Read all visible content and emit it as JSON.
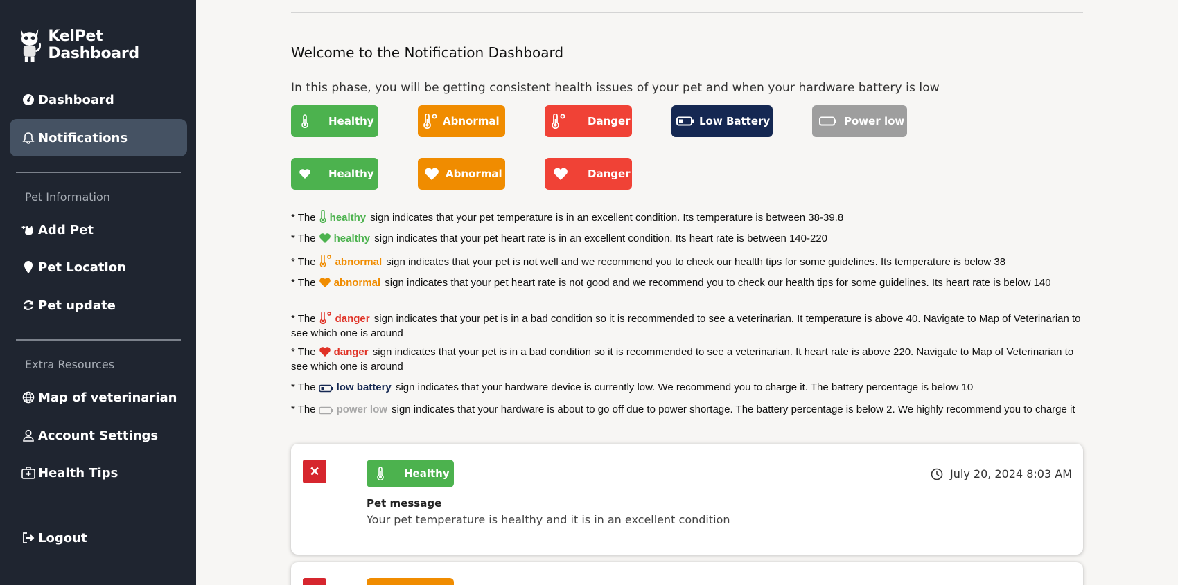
{
  "brand": {
    "title": "KelPet Dashboard"
  },
  "nav": {
    "dashboard": "Dashboard",
    "notifications": "Notifications",
    "pet_section": "Pet Information",
    "add_pet": "Add Pet",
    "pet_location": "Pet Location",
    "pet_update": "Pet update",
    "extra_section": "Extra Resources",
    "map_vet": "Map of veterinarian",
    "account": "Account Settings",
    "health_tips": "Health Tips",
    "logout": "Logout"
  },
  "page": {
    "title": "Welcome to the Notification Dashboard",
    "intro": "In this phase, you will be getting consistent health issues of your pet and when your hardware battery is low"
  },
  "badges": {
    "temp_healthy": "Healthy",
    "temp_abnormal": "Abnormal",
    "temp_danger": "Danger",
    "low_battery": "Low Battery",
    "power_low": "Power low",
    "heart_healthy": "Healthy",
    "heart_abnormal": "Abnormal",
    "heart_danger": "Danger"
  },
  "legend": [
    {
      "prefix": "* The",
      "keyword": "healthy",
      "rest": " sign indicates that your pet  temperature is in an excellent condition. Its temperature is between 38-39.8"
    },
    {
      "prefix": "* The",
      "keyword": "healthy",
      "rest": " sign indicates that your pet heart rate is in an excellent condition. Its heart rate is between 140-220"
    },
    {
      "prefix": "* The",
      "keyword": "abnormal",
      "rest": " sign indicates that your pet is not well and we recommend you to check our health tips for some guidelines. Its temperature is below 38"
    },
    {
      "prefix": "* The",
      "keyword": "abnormal",
      "rest": " sign indicates that your pet  heart rate is not good and we recommend you to check our health tips for some guidelines. Its heart rate is below 140"
    },
    {
      "prefix": "* The",
      "keyword": "danger",
      "rest": " sign indicates that your pet is in a bad condition so it is recommended to see a veterinarian. It temperature is above 40. Navigate to Map of Veterinarian to see which one is around"
    },
    {
      "prefix": "* The",
      "keyword": "danger",
      "rest": " sign indicates that your pet is in a bad condition so it is recommended to see a veterinarian. It heart rate is above 220. Navigate to Map of Veterinarian to see which one is around"
    },
    {
      "prefix": "* The",
      "keyword": "low battery",
      "rest": " sign indicates that your hardware device is currently low. We recommend you to charge it. The battery percentage is below 10"
    },
    {
      "prefix": "* The",
      "keyword": "power low",
      "rest": " sign indicates that your hardware is about to go off due to power shortage. The battery percentage is below 2. We highly recommend you to charge it"
    }
  ],
  "notification": {
    "close": "✕",
    "badge": "Healthy",
    "time": "July 20, 2024 8:03 AM",
    "title": "Pet message",
    "body": "Your pet temperature is healthy and it is in an excellent condition"
  },
  "notification2": {
    "close": "✕"
  },
  "colors": {
    "sidebar": "#1f2530",
    "active": "#455263",
    "green": "#4cb24e",
    "orange": "#f08c00",
    "red": "#f04236",
    "navy": "#152852",
    "grey": "#9e9e9e"
  }
}
